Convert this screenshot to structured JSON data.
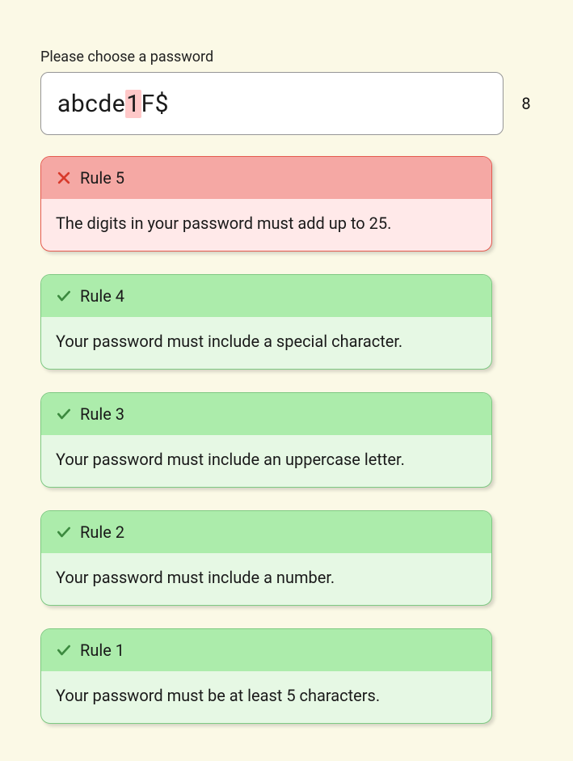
{
  "prompt": "Please choose a password",
  "password": {
    "pre": "abcde",
    "highlighted": "1",
    "post": "F$",
    "length": "8"
  },
  "colors": {
    "fail_icon": "#d83a2b",
    "pass_icon": "#3c8a3f"
  },
  "rules": [
    {
      "number": "Rule 5",
      "status": "fail",
      "text": "The digits in your password must add up to 25."
    },
    {
      "number": "Rule 4",
      "status": "pass",
      "text": "Your password must include a special character."
    },
    {
      "number": "Rule 3",
      "status": "pass",
      "text": "Your password must include an uppercase letter."
    },
    {
      "number": "Rule 2",
      "status": "pass",
      "text": "Your password must include a number."
    },
    {
      "number": "Rule 1",
      "status": "pass",
      "text": "Your password must be at least 5 characters."
    }
  ]
}
